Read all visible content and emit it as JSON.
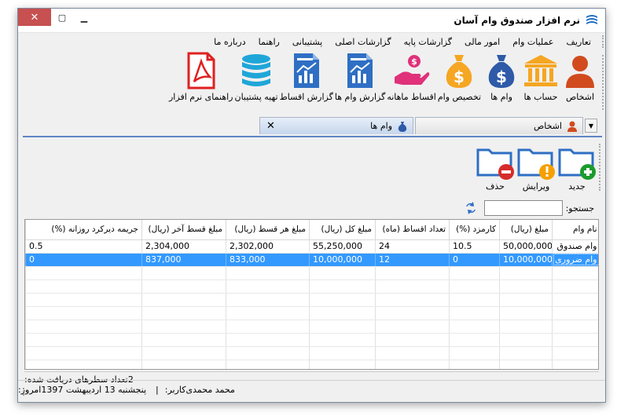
{
  "window": {
    "title": "نرم افزار صندوق وام آسان",
    "controls": [
      "minimize-icon",
      "maximize-icon",
      "close-icon"
    ]
  },
  "menu": [
    "تعاریف",
    "عملیات وام",
    "امور مالی",
    "گزارشات پایه",
    "گزارشات اصلی",
    "پشتیبانی",
    "راهنما",
    "درباره ما"
  ],
  "toolbar": [
    {
      "label": "اشخاص",
      "icon": "person-icon",
      "color": "#d14b1e"
    },
    {
      "label": "حساب ها",
      "icon": "bank-icon",
      "color": "#f5a623"
    },
    {
      "label": "وام ها",
      "icon": "money-bag-icon",
      "color": "#2e5aa8"
    },
    {
      "label": "تخصیص وام",
      "icon": "money-bag-icon",
      "color": "#f5a623"
    },
    {
      "label": "اقساط ماهانه",
      "icon": "hand-money-icon",
      "color": "#e0317a"
    },
    {
      "label": "گزارش وام ها",
      "icon": "report-chart-icon",
      "color": "#2e6fc4"
    },
    {
      "label": "گزارش اقساط",
      "icon": "report-chart-icon",
      "color": "#2e6fc4"
    },
    {
      "label": "تهیه پشتیبان",
      "icon": "database-icon",
      "color": "#1fa6d8"
    },
    {
      "label": "راهنمای نرم افزار",
      "icon": "pdf-icon",
      "color": "#e02020"
    }
  ],
  "tabs": [
    {
      "label": "اشخاص",
      "active": false
    },
    {
      "label": "وام ها",
      "active": true
    }
  ],
  "actions": [
    {
      "label": "جدید",
      "icon": "folder-add-icon",
      "badge_color": "#1a9c2c"
    },
    {
      "label": "ویرایش",
      "icon": "folder-edit-icon",
      "badge_color": "#f5a000"
    },
    {
      "label": "حذف",
      "icon": "folder-delete-icon",
      "badge_color": "#d62b2b"
    }
  ],
  "search": {
    "label": "جستجو:",
    "value": ""
  },
  "table": {
    "columns": [
      "نام وام",
      "مبلغ (ریال)",
      "کارمزد (%)",
      "تعداد اقساط (ماه)",
      "مبلغ کل (ریال)",
      "مبلغ هر قسط (ریال)",
      "مبلغ قسط آخر (ریال)",
      "جریمه دیرکرد روزانه (%)"
    ],
    "rows": [
      [
        "وام صندوق",
        "50,000,000",
        "10.5",
        "24",
        "55,250,000",
        "2,302,000",
        "2,304,000",
        "0.5"
      ],
      [
        "وام ضروری",
        "10,000,000",
        "0",
        "12",
        "10,000,000",
        "833,000",
        "837,000",
        "0"
      ]
    ],
    "selected_row": 1
  },
  "footer": {
    "count_label": "تعداد سطرهای دریافت شده:",
    "count_value": "2"
  },
  "status": {
    "today_label": "امروز:",
    "today_value": "پنجشنبه 13 اردیبهشت 1397",
    "separator": "|",
    "user_label": "کاربر:",
    "user_value": "محمد محمدی"
  }
}
